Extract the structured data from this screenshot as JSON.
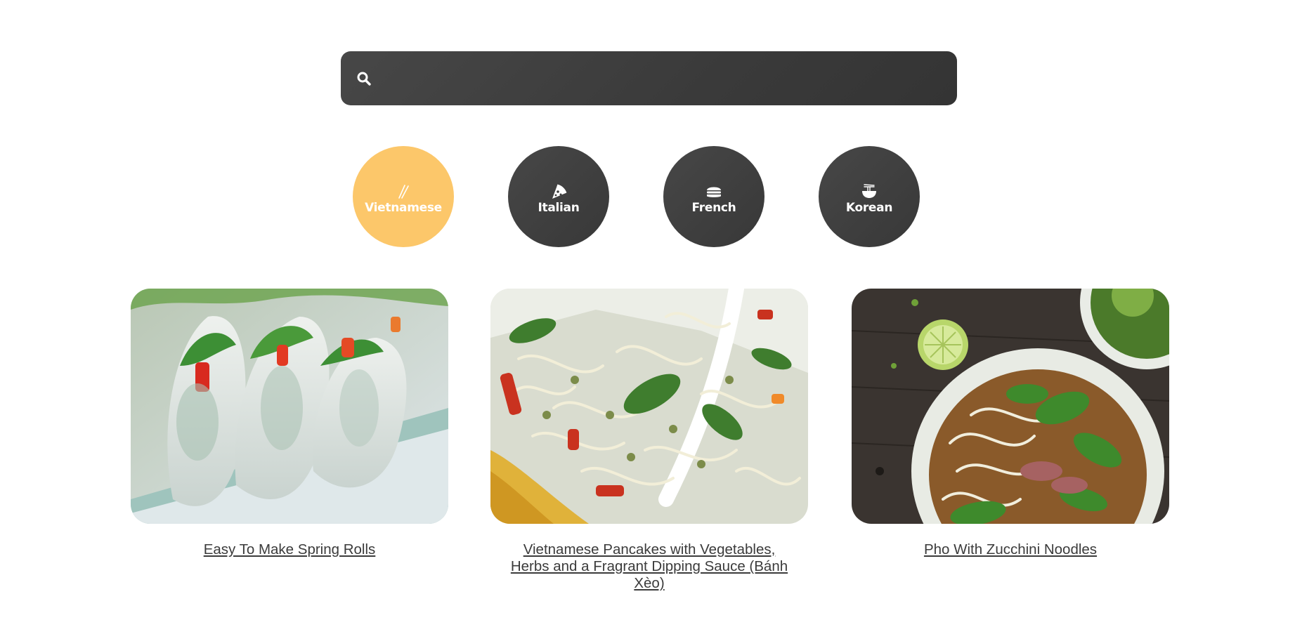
{
  "search": {
    "placeholder": "",
    "value": "",
    "icon": "search-icon"
  },
  "cuisines": [
    {
      "label": "Vietnamese",
      "icon": "chopsticks-icon",
      "active": true
    },
    {
      "label": "Italian",
      "icon": "pizza-icon",
      "active": false
    },
    {
      "label": "French",
      "icon": "burger-icon",
      "active": false
    },
    {
      "label": "Korean",
      "icon": "noodle-bowl-icon",
      "active": false
    }
  ],
  "recipes": [
    {
      "title": "Easy To Make Spring Rolls"
    },
    {
      "title": "Vietnamese Pancakes with Vegetables, Herbs and a Fragrant Dipping Sauce (Bánh Xèo)"
    },
    {
      "title": "Pho With Zucchini Noodles"
    }
  ],
  "colors": {
    "accent": "#fcc76a",
    "dark": "#3d3d3d",
    "text": "#3b3b3b"
  }
}
